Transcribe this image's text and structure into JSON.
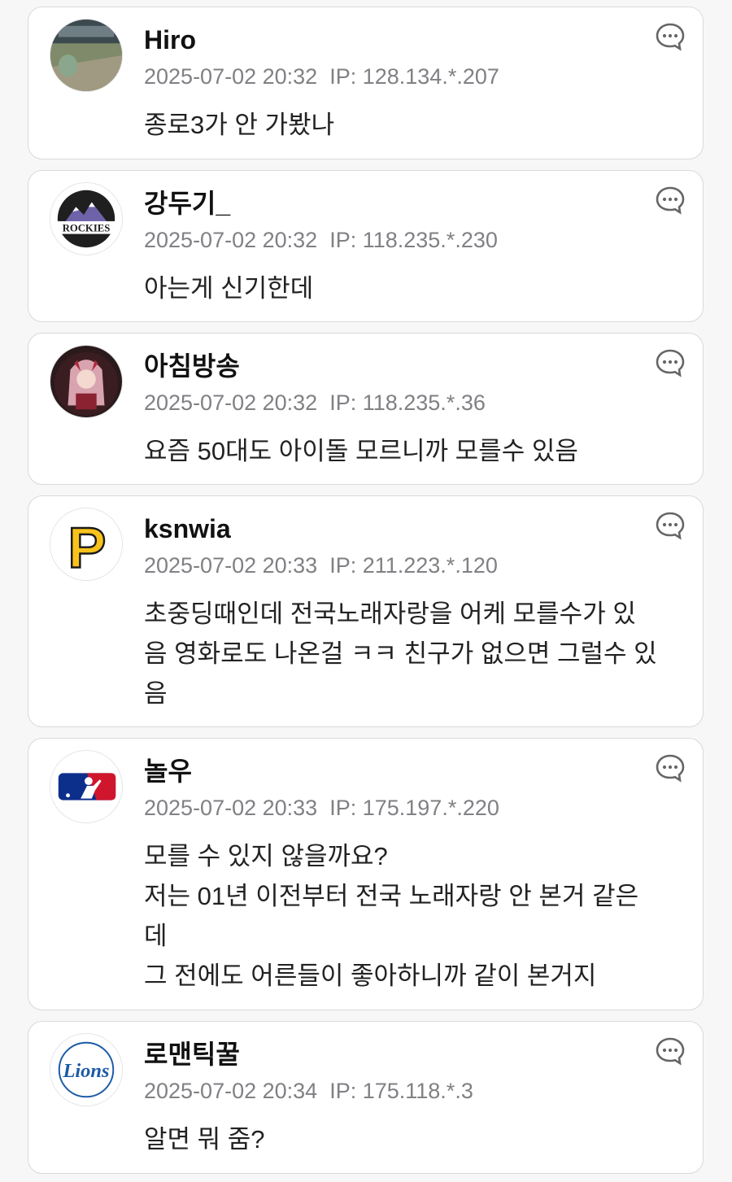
{
  "comments": [
    {
      "nickname": "Hiro",
      "timestamp": "2025-07-02 20:32",
      "ip": "IP: 128.134.*.207",
      "lines": [
        "종로3가 안 가봤나"
      ],
      "avatar": "stadium-photo"
    },
    {
      "nickname": "강두기_",
      "timestamp": "2025-07-02 20:32",
      "ip": "IP: 118.235.*.230",
      "lines": [
        "아는게 신기한데"
      ],
      "avatar": "rockies-logo",
      "avatar_text": "ROCKIES"
    },
    {
      "nickname": "아침방송",
      "timestamp": "2025-07-02 20:32",
      "ip": "IP: 118.235.*.36",
      "lines": [
        "요즘 50대도 아이돌 모르니까 모를수 있음"
      ],
      "avatar": "anime-character"
    },
    {
      "nickname": "ksnwia",
      "timestamp": "2025-07-02 20:33",
      "ip": "IP: 211.223.*.120",
      "lines": [
        "초중딩때인데 전국노래자랑을 어케 모를수가 있",
        "음 영화로도 나온걸 ㅋㅋ 친구가 없으면 그럴수 있",
        "음"
      ],
      "avatar": "pirates-logo",
      "avatar_text": "P"
    },
    {
      "nickname": "놀우",
      "timestamp": "2025-07-02 20:33",
      "ip": "IP: 175.197.*.220",
      "lines": [
        "모를 수 있지 않을까요?",
        "저는 01년 이전부터 전국 노래자랑 안 본거 같은",
        "데",
        "그 전에도 어른들이 좋아하니까 같이 본거지"
      ],
      "avatar": "mlb-logo"
    },
    {
      "nickname": "로맨틱꿀",
      "timestamp": "2025-07-02 20:34",
      "ip": "IP: 175.118.*.3",
      "lines": [
        "알면 뭐 줌?"
      ],
      "avatar": "lions-logo",
      "avatar_text": "Lions"
    }
  ],
  "colors": {
    "meta": "#808085",
    "border": "#d9d9dc",
    "pirates_gold": "#f9c21b",
    "mlb_blue": "#0d2f8c",
    "mlb_red": "#d0162d",
    "lions_blue": "#1b5aa6"
  }
}
